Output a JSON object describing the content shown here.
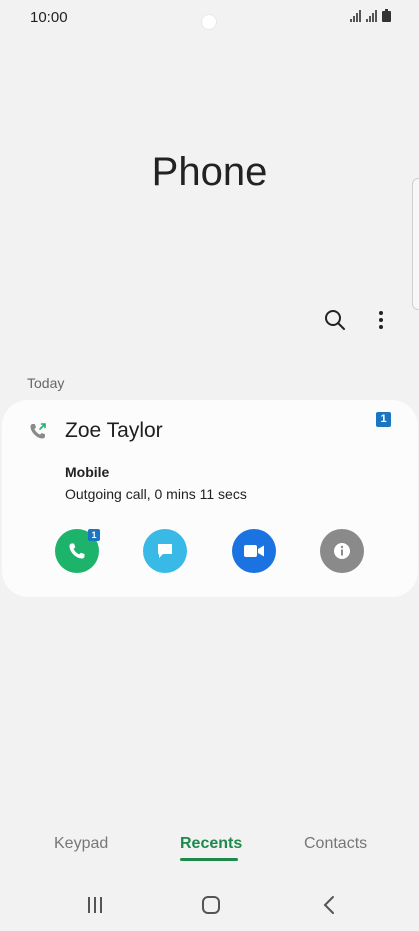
{
  "status_bar": {
    "time": "10:00"
  },
  "app": {
    "title": "Phone"
  },
  "toolbar": {
    "search_icon": "search-icon",
    "more_icon": "more-options-icon"
  },
  "recents": {
    "section_label": "Today",
    "entries": [
      {
        "name": "Zoe Taylor",
        "sim_badge": "1",
        "number_type": "Mobile",
        "detail": "Outgoing call, 0 mins 11 secs",
        "call_sim_badge": "1",
        "actions": [
          "call-icon",
          "message-icon",
          "video-call-icon",
          "info-icon"
        ]
      }
    ]
  },
  "tabs": [
    {
      "label": "Keypad",
      "active": false
    },
    {
      "label": "Recents",
      "active": true
    },
    {
      "label": "Contacts",
      "active": false
    }
  ],
  "colors": {
    "accent": "#1d8a4c",
    "call": "#1eb36a",
    "message": "#39b9e6",
    "video": "#1a73e0",
    "info": "#8a8a8a",
    "sim": "#1b75c0"
  }
}
